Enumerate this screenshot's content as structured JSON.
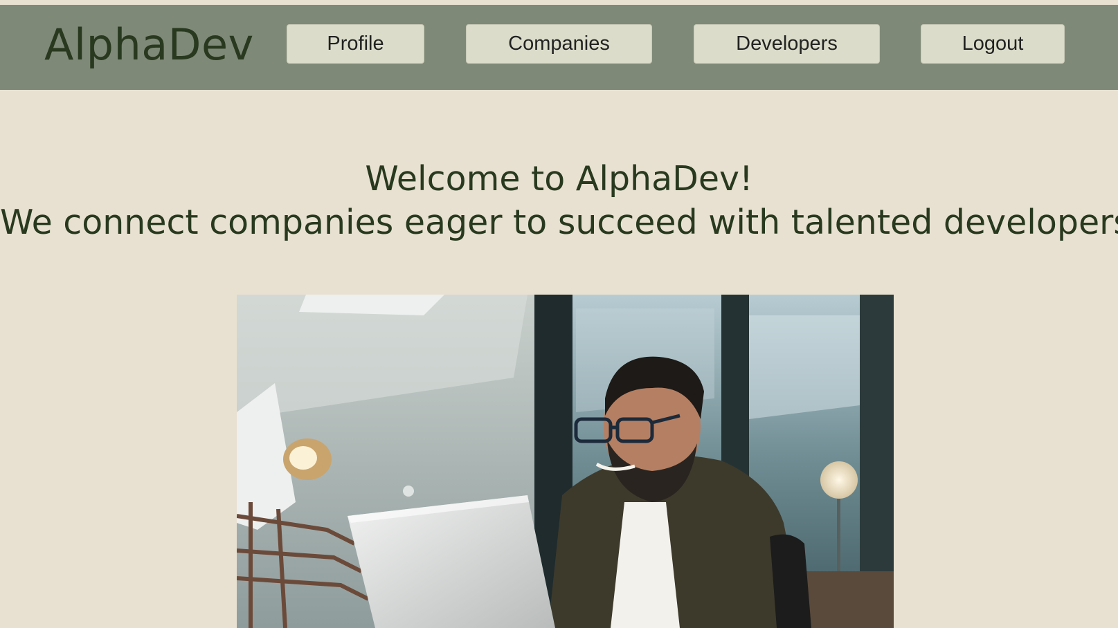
{
  "header": {
    "logo": "AlphaDev",
    "nav": {
      "profile": "Profile",
      "companies": "Companies",
      "developers": "Developers",
      "logout": "Logout"
    }
  },
  "main": {
    "welcome": "Welcome to AlphaDev!",
    "tagline": "We connect companies eager to succeed with talented developers."
  },
  "colors": {
    "header_bg": "#7f8977",
    "page_bg": "#e8e1d1",
    "button_bg": "#dcdccb",
    "text_dark_green": "#28391f"
  }
}
